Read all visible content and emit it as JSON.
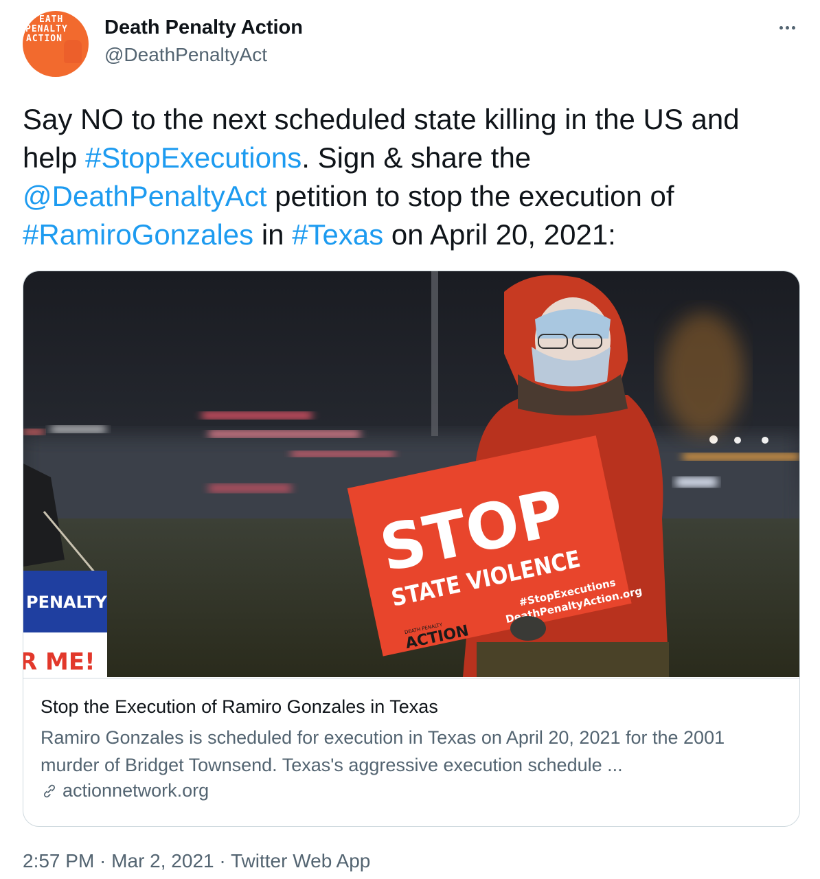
{
  "author": {
    "name": "Death Penalty Action",
    "handle": "@DeathPenaltyAct",
    "avatar_logo": [
      "EATH",
      "PENALTY",
      "ACTION"
    ]
  },
  "tweet": {
    "line1": "Say NO to the next scheduled state killing in the US and",
    "help": "help ",
    "hashtag_stop": "#StopExecutions",
    "after_stop": ". Sign & share the",
    "mention": "@DeathPenaltyAct",
    "after_mention": " petition to stop the execution of",
    "hashtag_ramiro": "#RamiroGonzales",
    "in": " in ",
    "hashtag_texas": "#Texas",
    "after_texas": " on April 20, 2021:"
  },
  "photo": {
    "sign_main": "STOP",
    "sign_sub": "STATE VIOLENCE",
    "sign_hashtag": "#StopExecutions",
    "sign_url": "DeathPenaltyAction.org",
    "sign_logo_small": "DEATH PENALTY",
    "sign_logo": "ACTION",
    "left_sign_top": "PENALTY",
    "left_sign_bottom": "R ME!"
  },
  "card": {
    "title": "Stop the Execution of Ramiro Gonzales in Texas",
    "description": "Ramiro Gonzales is scheduled for execution in Texas on April 20, 2021 for the 2001 murder of Bridget Townsend. Texas's aggressive execution schedule ...",
    "domain": "actionnetwork.org"
  },
  "footer": {
    "time": "2:57 PM",
    "date": "Mar 2, 2021",
    "source": "Twitter Web App",
    "sep": " · "
  },
  "colors": {
    "link": "#1d9bf0",
    "secondary": "#536471",
    "avatar": "#f26a2e",
    "sign": "#e8452c"
  }
}
